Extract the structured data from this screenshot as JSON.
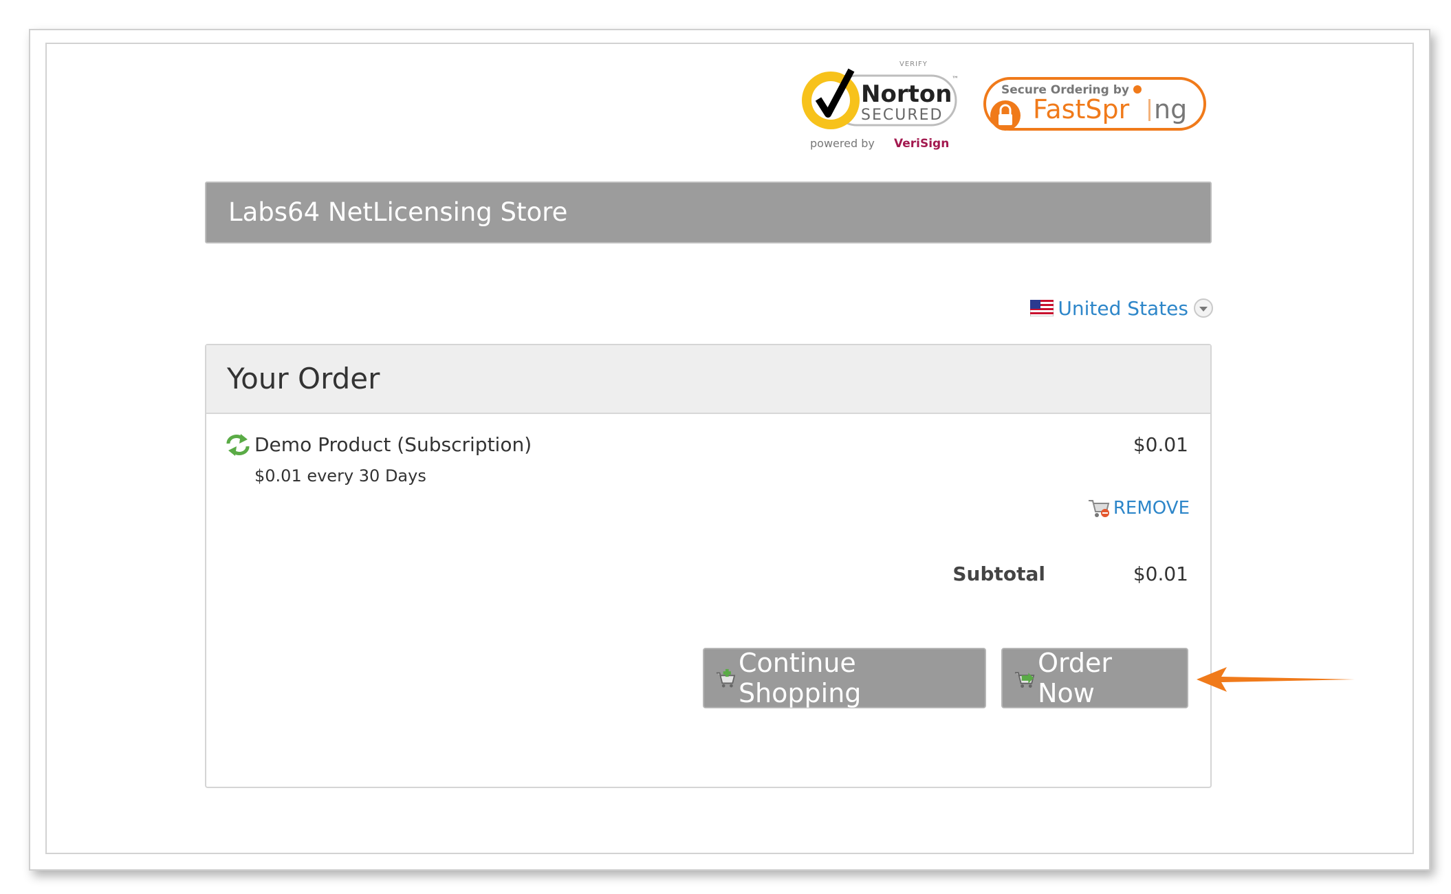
{
  "badges": {
    "norton": {
      "verify": "VERIFY",
      "name": "Norton",
      "secured": "SECURED",
      "powered_by": "powered by",
      "verisign": "VeriSign",
      "tm": "™"
    },
    "fastspring": {
      "secure_ordering": "Secure Ordering by",
      "name_part1": "FastSpr",
      "name_part2": "ng"
    }
  },
  "store": {
    "title": "Labs64 NetLicensing Store"
  },
  "country": {
    "label": "United States",
    "icon": "us-flag-icon"
  },
  "order": {
    "heading": "Your Order",
    "items": [
      {
        "name": "Demo Product (Subscription)",
        "detail": "$0.01 every 30 Days",
        "price": "$0.01",
        "remove_label": "REMOVE"
      }
    ],
    "subtotal_label": "Subtotal",
    "subtotal_value": "$0.01",
    "continue_label": "Continue Shopping",
    "order_now_label": "Order Now"
  },
  "colors": {
    "accent_link": "#2d86c9",
    "header_bg": "#9c9c9c",
    "button_bg": "#9a9a9a",
    "callout_arrow": "#f07a1a"
  }
}
